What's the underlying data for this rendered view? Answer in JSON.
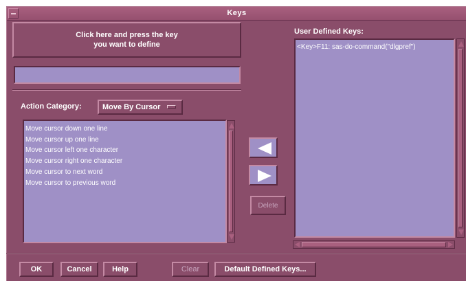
{
  "window": {
    "title": "Keys"
  },
  "define_button": {
    "label": "Click here and press the key you want to define"
  },
  "key_field": {
    "value": ""
  },
  "action_category": {
    "label": "Action Category:",
    "selected": "Move By Cursor"
  },
  "actions": [
    "Move cursor down one line",
    "Move cursor up one line",
    "Move cursor left one character",
    "Move cursor right one character",
    "Move cursor to next word",
    "Move cursor to previous word"
  ],
  "delete_button": {
    "label": "Delete"
  },
  "user_defined": {
    "label": "User Defined Keys:",
    "items": [
      "<Key>F11: sas-do-command(\"dlgpref\")"
    ]
  },
  "footer": {
    "ok": "OK",
    "cancel": "Cancel",
    "help": "Help",
    "clear": "Clear",
    "default_keys": "Default Defined Keys..."
  },
  "colors": {
    "window_bg": "#8a4d6a",
    "list_bg": "#9f90c6",
    "text": "#ffffff"
  },
  "icons": [
    "window-menu-icon",
    "arrow-left-icon",
    "arrow-right-icon",
    "option-menu-indicator-icon"
  ]
}
